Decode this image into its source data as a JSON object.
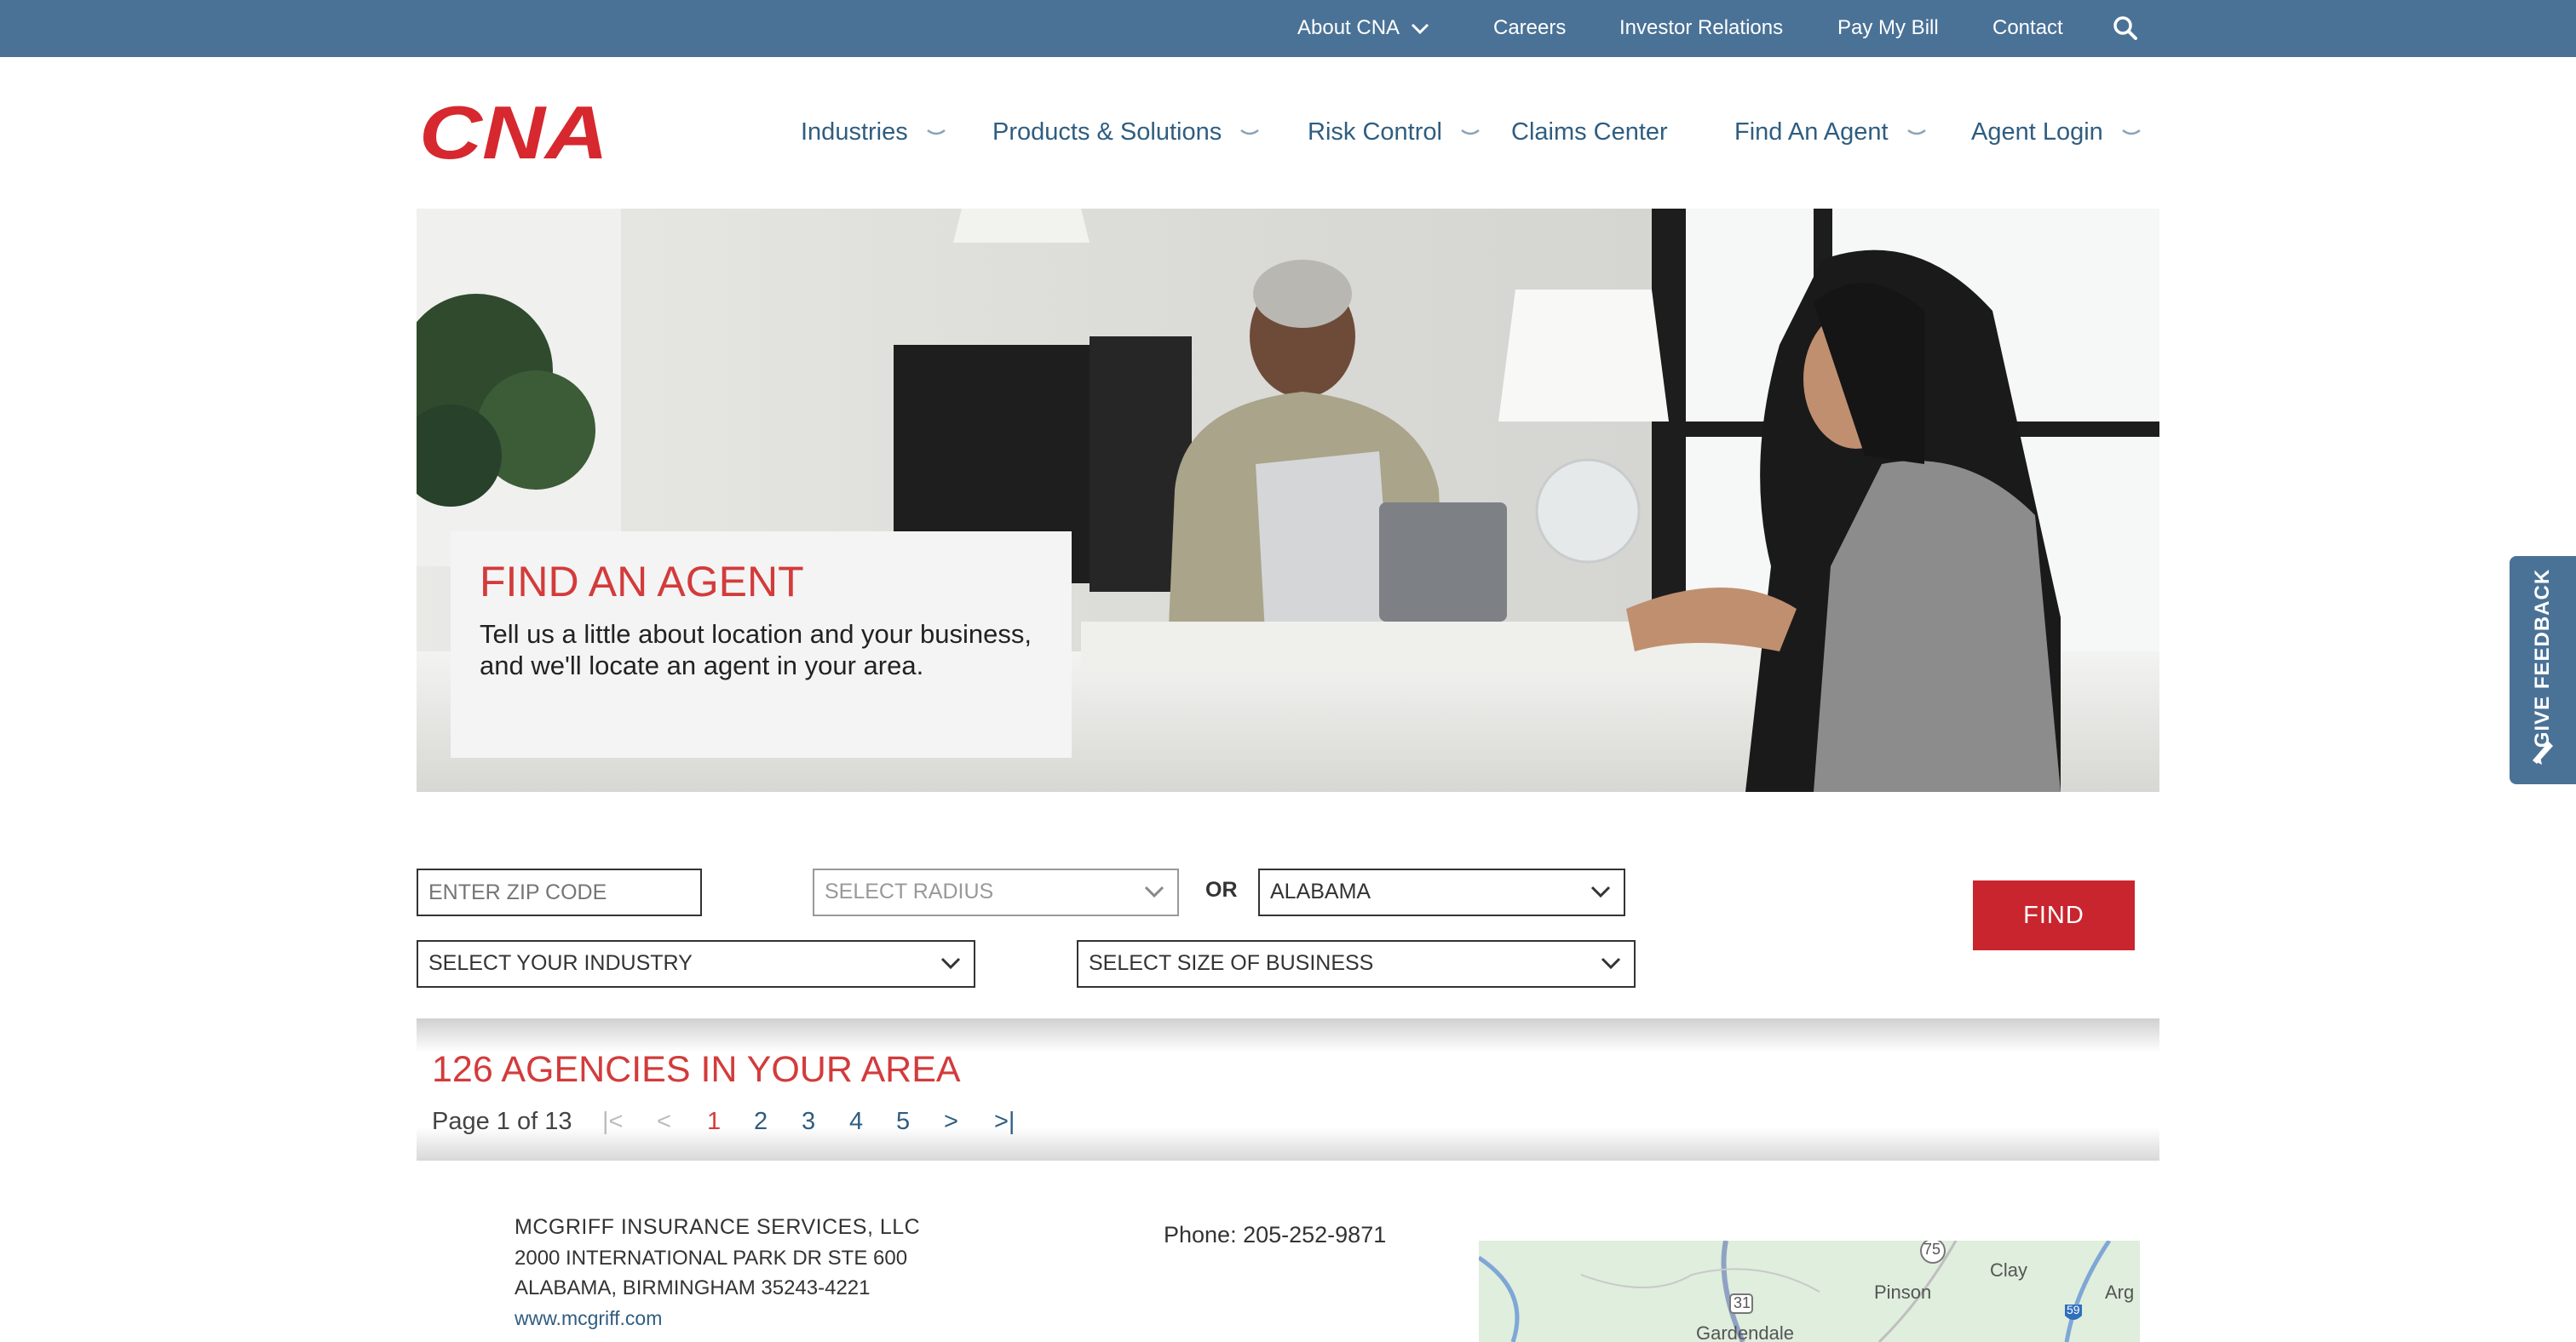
{
  "utility_nav": {
    "about": "About CNA",
    "careers": "Careers",
    "investor": "Investor Relations",
    "pay": "Pay My Bill",
    "contact": "Contact",
    "search_icon": "search-icon"
  },
  "brand": {
    "logo_text": "CNA",
    "color": "#d6282e"
  },
  "main_nav": {
    "industries": "Industries",
    "products": "Products & Solutions",
    "risk": "Risk Control",
    "claims": "Claims Center",
    "find_agent": "Find An Agent",
    "agent_login": "Agent Login"
  },
  "hero": {
    "title": "FIND AN AGENT",
    "text": "Tell us a little about location and your business, and we'll locate an agent in your area."
  },
  "feedback": {
    "label": "GIVE FEEDBACK",
    "icon": "megaphone-icon"
  },
  "form": {
    "zip_placeholder": "ENTER ZIP CODE",
    "radius": "SELECT RADIUS",
    "or": "OR",
    "state": "ALABAMA",
    "industry": "SELECT YOUR INDUSTRY",
    "size": "SELECT SIZE OF BUSINESS",
    "find": "FIND"
  },
  "results": {
    "title": "126 AGENCIES IN YOUR AREA",
    "page_info": "Page 1 of 13",
    "first": "|<",
    "prev": "<",
    "pages": [
      "1",
      "2",
      "3",
      "4",
      "5"
    ],
    "next": ">",
    "last": ">|"
  },
  "listing": {
    "name": "MCGRIFF INSURANCE SERVICES, LLC",
    "address1": "2000 INTERNATIONAL PARK DR STE 600",
    "address2": "ALABAMA, BIRMINGHAM 35243-4221",
    "url": "www.mcgriff.com",
    "phone": "Phone: 205-252-9871",
    "map_labels": {
      "pinson": "Pinson",
      "clay": "Clay",
      "gardendale": "Gardendale",
      "arg": "Arg",
      "r75": "75",
      "r31": "31",
      "r59": "59"
    }
  },
  "colors": {
    "utility_bar": "#4a7296",
    "accent_red": "#d33b3b",
    "button_red": "#c8252e",
    "nav_blue": "#2f5d80"
  }
}
